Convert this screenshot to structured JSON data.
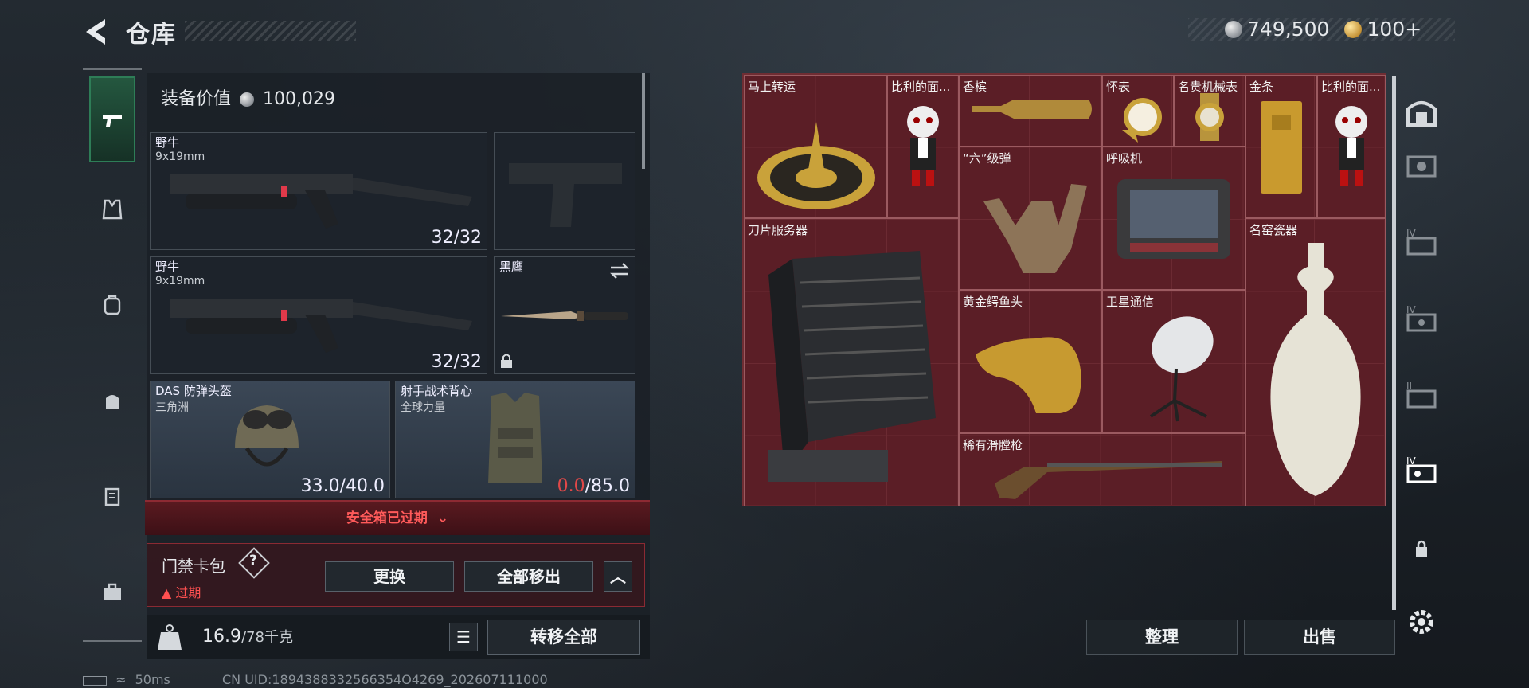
{
  "header": {
    "title": "仓库",
    "back_icon": "back-arrow-icon"
  },
  "currency": {
    "silver": "749,500",
    "gold": "100+"
  },
  "left_rail": {
    "tabs": [
      "pistol-icon",
      "vest-icon",
      "backpack-icon",
      "bag-icon",
      "case-icon",
      "toolbox-icon"
    ],
    "active": 0
  },
  "equipment": {
    "value_label": "装备价值",
    "value": "100,029",
    "slots": [
      {
        "name": "野牛",
        "sub": "9x19mm",
        "count": "32/32"
      },
      {
        "name": "",
        "sub": "",
        "count": ""
      },
      {
        "name": "野牛",
        "sub": "9x19mm",
        "count": "32/32"
      },
      {
        "name": "黑鹰",
        "sub": "",
        "count": ""
      },
      {
        "name": "DAS 防弹头盔",
        "sub": "三角洲",
        "count": "33.0/40.0"
      },
      {
        "name": "射手战术背心",
        "sub": "全球力量",
        "count_red": "0.0",
        "count_rest": "/85.0"
      }
    ]
  },
  "safe_box": {
    "label": "安全箱已过期"
  },
  "card_pack": {
    "title": "门禁卡包",
    "help": "?",
    "status": "过期",
    "swap_label": "更换",
    "remove_all_label": "全部移出"
  },
  "weight": {
    "current": "16.9",
    "max": "/78千克",
    "transfer_all": "转移全部"
  },
  "stash": {
    "items": [
      {
        "label": "马上转运"
      },
      {
        "label": "比利的面..."
      },
      {
        "label": "香槟"
      },
      {
        "label": "怀表"
      },
      {
        "label": "名贵机械表"
      },
      {
        "label": "金条"
      },
      {
        "label": "比利的面..."
      },
      {
        "label": "“六”级弹"
      },
      {
        "label": "呼吸机"
      },
      {
        "label": "刀片服务器"
      },
      {
        "label": "名窑瓷器"
      },
      {
        "label": "黄金鳄鱼头"
      },
      {
        "label": "卫星通信"
      },
      {
        "label": "稀有滑膛枪"
      }
    ],
    "organize_label": "整理",
    "sell_label": "出售"
  },
  "right_rail": {
    "icons": [
      "vault-icon",
      "stash-2-icon",
      "stash-iv-a-icon",
      "stash-iv-b-icon",
      "stash-ii-icon",
      "stash-iv-active-icon",
      "lock-icon",
      "settings-icon"
    ]
  },
  "status_bar": {
    "ping": "50ms",
    "uid": "CN UID:1894388332566354O4269_202607111000"
  }
}
